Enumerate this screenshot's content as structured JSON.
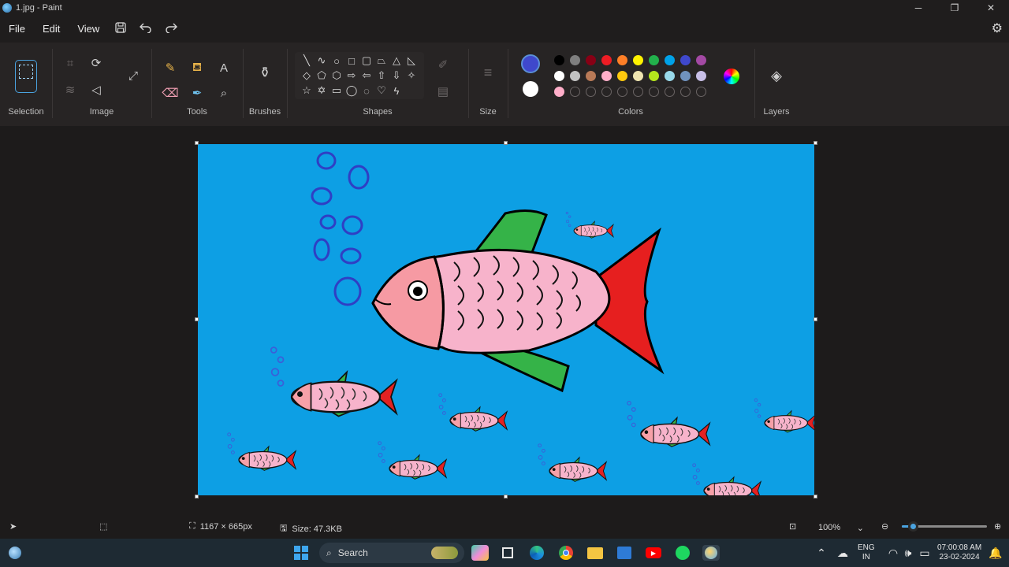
{
  "title": "1.jpg - Paint",
  "window_controls": {
    "minimize": "─",
    "maximize": "❐",
    "close": "✕"
  },
  "menu": {
    "file": "File",
    "edit": "Edit",
    "view": "View"
  },
  "ribbon": {
    "selection_label": "Selection",
    "image_label": "Image",
    "tools_label": "Tools",
    "brushes_label": "Brushes",
    "shapes_label": "Shapes",
    "size_label": "Size",
    "colors_label": "Colors",
    "layers_label": "Layers"
  },
  "colors": {
    "primary": "#3f48cc",
    "secondary": "#ffffff",
    "row1": [
      "#000000",
      "#7f7f7f",
      "#880015",
      "#ed1c24",
      "#ff7f27",
      "#fff200",
      "#22b14c",
      "#00a2e8",
      "#3f48cc",
      "#a349a4"
    ],
    "row2": [
      "#ffffff",
      "#c3c3c3",
      "#b97a57",
      "#ffaec9",
      "#ffc90e",
      "#efe4b0",
      "#b5e61d",
      "#99d9ea",
      "#7092be",
      "#c8bfe7"
    ],
    "row3": [
      "#ffaec9"
    ]
  },
  "status": {
    "canvas_size": "1167 × 665px",
    "file_size": "Size: 47.3KB",
    "zoom": "100%",
    "zoom_fraction": 0.13
  },
  "taskbar": {
    "search_placeholder": "Search",
    "lang_top": "ENG",
    "lang_bottom": "IN",
    "time": "07:00:08 AM",
    "date": "23-02-2024"
  }
}
